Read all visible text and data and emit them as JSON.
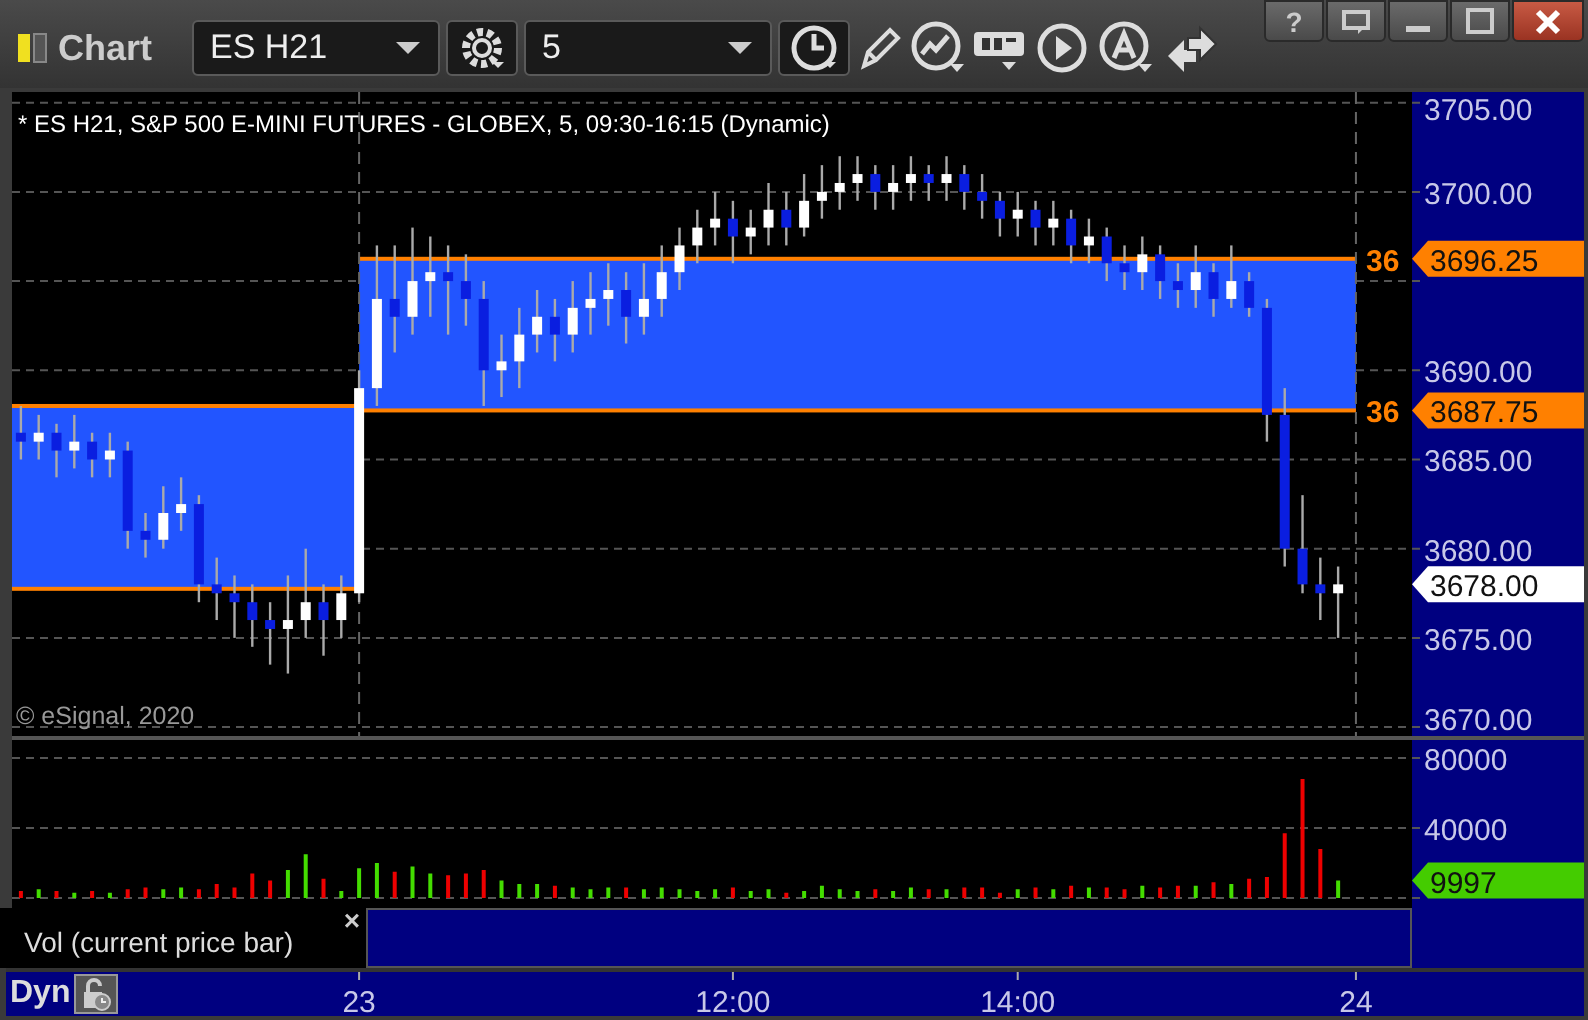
{
  "toolbar": {
    "title": "Chart",
    "symbol": {
      "value": "ES H21"
    },
    "interval": {
      "value": "5"
    },
    "help_button": "?"
  },
  "price_pane": {
    "caption": "* ES H21, S&P 500 E-MINI FUTURES - GLOBEX, 5, 09:30-16:15 (Dynamic)",
    "copyright": "© eSignal, 2020",
    "price_tags": [
      {
        "kind": "level",
        "text": "3696.25",
        "side_label": "36"
      },
      {
        "kind": "level",
        "text": "3687.75",
        "side_label": "36"
      },
      {
        "kind": "last",
        "text": "3678.00"
      }
    ],
    "chart_data": {
      "type": "candlestick",
      "grid": true,
      "ylim": [
        3669.5,
        3705.6
      ],
      "yticks": [
        {
          "value": 3670,
          "label": "3670.00"
        },
        {
          "value": 3675,
          "label": "3675.00"
        },
        {
          "value": 3680,
          "label": "3680.00"
        },
        {
          "value": 3685,
          "label": "3685.00"
        },
        {
          "value": 3690,
          "label": "3690.00"
        },
        {
          "value": 3700,
          "label": "3700.00"
        },
        {
          "value": 3705,
          "label": "3705.00"
        }
      ],
      "ohlc": [
        [
          3686.5,
          3688,
          3685,
          3686
        ],
        [
          3686,
          3687.5,
          3685,
          3686.5
        ],
        [
          3686.5,
          3687,
          3684,
          3685.5
        ],
        [
          3685.5,
          3687.5,
          3684.5,
          3686
        ],
        [
          3686,
          3686.5,
          3684,
          3685
        ],
        [
          3685,
          3686.5,
          3684,
          3685.5
        ],
        [
          3685.5,
          3686,
          3680,
          3681
        ],
        [
          3681,
          3682,
          3679.5,
          3680.5
        ],
        [
          3680.5,
          3683.5,
          3680,
          3682
        ],
        [
          3682,
          3684,
          3681,
          3682.5
        ],
        [
          3682.5,
          3683,
          3677,
          3678
        ],
        [
          3678,
          3679.5,
          3676,
          3677.5
        ],
        [
          3677.5,
          3678.5,
          3675,
          3677
        ],
        [
          3677,
          3678,
          3674.5,
          3676
        ],
        [
          3676,
          3677,
          3673.5,
          3675.5
        ],
        [
          3675.5,
          3678.5,
          3673,
          3676
        ],
        [
          3676,
          3680,
          3675,
          3677
        ],
        [
          3677,
          3678,
          3674,
          3676
        ],
        [
          3676,
          3678.5,
          3675,
          3677.5
        ],
        [
          3677.5,
          3690,
          3677,
          3689
        ],
        [
          3689,
          3697,
          3688,
          3694
        ],
        [
          3694,
          3697,
          3691,
          3693
        ],
        [
          3693,
          3698,
          3692,
          3695
        ],
        [
          3695,
          3697.5,
          3693,
          3695.5
        ],
        [
          3695.5,
          3697,
          3692,
          3695
        ],
        [
          3695,
          3696.5,
          3692.5,
          3694
        ],
        [
          3694,
          3695,
          3688,
          3690
        ],
        [
          3690,
          3692,
          3688.5,
          3690.5
        ],
        [
          3690.5,
          3693.5,
          3689,
          3692
        ],
        [
          3692,
          3694.5,
          3691,
          3693
        ],
        [
          3693,
          3694,
          3690.5,
          3692
        ],
        [
          3692,
          3695,
          3691,
          3693.5
        ],
        [
          3693.5,
          3695.5,
          3692,
          3694
        ],
        [
          3694,
          3696,
          3692.5,
          3694.5
        ],
        [
          3694.5,
          3695.5,
          3691.5,
          3693
        ],
        [
          3693,
          3696,
          3692,
          3694
        ],
        [
          3694,
          3697,
          3693,
          3695.5
        ],
        [
          3695.5,
          3698,
          3694.5,
          3697
        ],
        [
          3697,
          3699,
          3696,
          3698
        ],
        [
          3698,
          3700,
          3697,
          3698.5
        ],
        [
          3698.5,
          3699.5,
          3696,
          3697.5
        ],
        [
          3697.5,
          3699,
          3696.5,
          3698
        ],
        [
          3698,
          3700.5,
          3697,
          3699
        ],
        [
          3699,
          3700,
          3697,
          3698
        ],
        [
          3698,
          3701,
          3697.5,
          3699.5
        ],
        [
          3699.5,
          3701.5,
          3698.5,
          3700
        ],
        [
          3700,
          3702,
          3699,
          3700.5
        ],
        [
          3700.5,
          3702,
          3699.5,
          3701
        ],
        [
          3701,
          3701.5,
          3699,
          3700
        ],
        [
          3700,
          3701.5,
          3699,
          3700.5
        ],
        [
          3700.5,
          3702,
          3699.5,
          3701
        ],
        [
          3701,
          3701.5,
          3699.5,
          3700.5
        ],
        [
          3700.5,
          3702,
          3699.5,
          3701
        ],
        [
          3701,
          3701.5,
          3699,
          3700
        ],
        [
          3700,
          3701,
          3698.5,
          3699.5
        ],
        [
          3699.5,
          3700,
          3697.5,
          3698.5
        ],
        [
          3698.5,
          3700,
          3697.5,
          3699
        ],
        [
          3699,
          3699.5,
          3697,
          3698
        ],
        [
          3698,
          3699.5,
          3697,
          3698.5
        ],
        [
          3698.5,
          3699,
          3696,
          3697
        ],
        [
          3697,
          3698.5,
          3696,
          3697.5
        ],
        [
          3697.5,
          3698,
          3695,
          3696
        ],
        [
          3696,
          3697,
          3694.5,
          3695.5
        ],
        [
          3695.5,
          3697.5,
          3694.5,
          3696.5
        ],
        [
          3696.5,
          3697,
          3694,
          3695
        ],
        [
          3695,
          3696,
          3693.5,
          3694.5
        ],
        [
          3694.5,
          3697,
          3693.5,
          3695.5
        ],
        [
          3695.5,
          3696,
          3693,
          3694
        ],
        [
          3694,
          3697,
          3693.5,
          3695
        ],
        [
          3695,
          3695.5,
          3693,
          3693.5
        ],
        [
          3693.5,
          3694,
          3686,
          3687.5
        ],
        [
          3687.5,
          3689,
          3679,
          3680
        ],
        [
          3680,
          3683,
          3677.5,
          3678
        ],
        [
          3678,
          3679.5,
          3676,
          3677.5
        ],
        [
          3677.5,
          3679,
          3675,
          3678
        ],
        null
      ],
      "bands": [
        {
          "axis": "y",
          "from": 3677.75,
          "to": 3688
        },
        {
          "axis": "y",
          "from": 3687.75,
          "to": 3696.25
        }
      ],
      "ref_lines": [
        {
          "axis": "x",
          "value": "23"
        },
        {
          "axis": "x",
          "value": "24"
        }
      ]
    }
  },
  "volume_pane": {
    "legend": "Vol (current price bar)",
    "close_glyph": "×",
    "tag": "9997",
    "chart_data": {
      "type": "bar",
      "grid": true,
      "ylim": [
        0,
        80000
      ],
      "yticks": [
        40000,
        80000
      ],
      "categories": [
        null,
        null,
        null,
        null,
        null,
        null,
        null,
        null,
        null,
        null,
        null,
        null,
        null,
        null,
        null,
        null,
        null,
        null,
        null,
        "23",
        null,
        null,
        null,
        null,
        null,
        null,
        null,
        null,
        null,
        null,
        null,
        null,
        null,
        null,
        null,
        null,
        null,
        null,
        null,
        null,
        "12:00",
        null,
        null,
        null,
        null,
        null,
        null,
        null,
        null,
        null,
        null,
        null,
        null,
        null,
        null,
        null,
        "14:00",
        null,
        null,
        null,
        null,
        null,
        null,
        null,
        null,
        null,
        null,
        null,
        null,
        null,
        null,
        null,
        null,
        null,
        null,
        "24"
      ],
      "values": [
        4000,
        5000,
        4000,
        3000,
        4000,
        3000,
        5000,
        6000,
        5000,
        6000,
        5000,
        8000,
        6000,
        14000,
        10000,
        16000,
        25000,
        11000,
        4000,
        17000,
        20000,
        15000,
        18000,
        14000,
        13000,
        14000,
        16000,
        10000,
        8000,
        8000,
        7000,
        6000,
        5000,
        6000,
        6000,
        5000,
        6000,
        5000,
        4000,
        5000,
        6000,
        4000,
        5000,
        3000,
        4000,
        7000,
        5000,
        4000,
        5000,
        4000,
        6000,
        5000,
        5000,
        6000,
        6000,
        3000,
        5000,
        6000,
        5000,
        7000,
        6000,
        6000,
        5000,
        7000,
        6000,
        7000,
        7000,
        9000,
        8000,
        11000,
        12000,
        37000,
        68000,
        28000,
        10000,
        null
      ],
      "colors": [
        "#ee0000",
        "#44dd00",
        "#ee0000",
        "#44dd00",
        "#ee0000",
        "#44dd00",
        "#ee0000",
        "#ee0000",
        "#44dd00",
        "#44dd00",
        "#ee0000",
        "#ee0000",
        "#ee0000",
        "#ee0000",
        "#ee0000",
        "#44dd00",
        "#44dd00",
        "#ee0000",
        "#44dd00",
        "#44dd00",
        "#44dd00",
        "#ee0000",
        "#44dd00",
        "#44dd00",
        "#ee0000",
        "#ee0000",
        "#ee0000",
        "#44dd00",
        "#44dd00",
        "#44dd00",
        "#ee0000",
        "#44dd00",
        "#44dd00",
        "#44dd00",
        "#ee0000",
        "#44dd00",
        "#44dd00",
        "#44dd00",
        "#44dd00",
        "#44dd00",
        "#ee0000",
        "#44dd00",
        "#44dd00",
        "#ee0000",
        "#44dd00",
        "#44dd00",
        "#44dd00",
        "#44dd00",
        "#ee0000",
        "#44dd00",
        "#44dd00",
        "#ee0000",
        "#44dd00",
        "#ee0000",
        "#ee0000",
        "#ee0000",
        "#44dd00",
        "#ee0000",
        "#44dd00",
        "#ee0000",
        "#44dd00",
        "#ee0000",
        "#ee0000",
        "#44dd00",
        "#ee0000",
        "#ee0000",
        "#44dd00",
        "#ee0000",
        "#44dd00",
        "#ee0000",
        "#ee0000",
        "#ee0000",
        "#ee0000",
        "#ee0000",
        "#44dd00",
        null
      ]
    }
  },
  "footer": {
    "mode": "Dyn"
  }
}
